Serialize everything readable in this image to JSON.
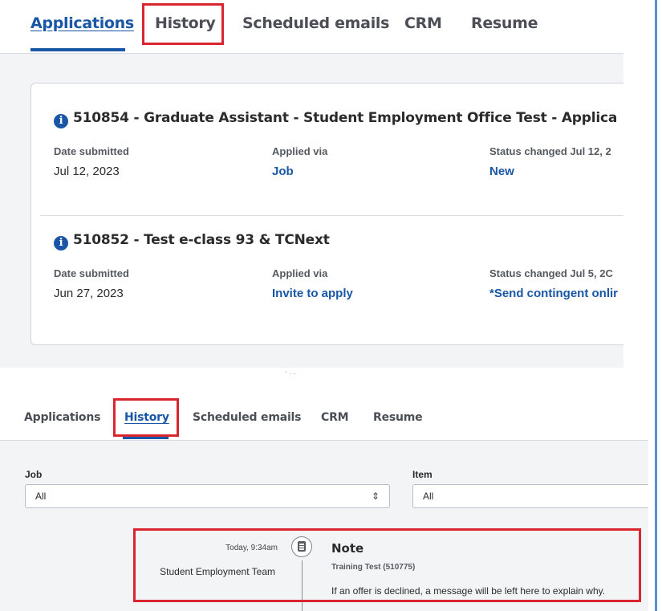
{
  "top_panel": {
    "tabs": [
      {
        "label": "Applications"
      },
      {
        "label": "History"
      },
      {
        "label": "Scheduled emails"
      },
      {
        "label": "CRM"
      },
      {
        "label": "Resume"
      }
    ],
    "applications": [
      {
        "title": "510854 - Graduate Assistant - Student Employment Office Test - Applica",
        "date_label": "Date submitted",
        "date_value": "Jul 12, 2023",
        "via_label": "Applied via",
        "via_value": "Job",
        "status_label": "Status changed Jul 12, 2",
        "status_value": "New"
      },
      {
        "title": "510852 - Test e-class 93 & TCNext",
        "date_label": "Date submitted",
        "date_value": "Jun 27, 2023",
        "via_label": "Applied via",
        "via_value": "Invite to apply",
        "status_label": "Status changed Jul 5, 2C",
        "status_value": "*Send contingent onlir"
      }
    ]
  },
  "bottom_panel": {
    "faint_text": "- ...",
    "tabs": [
      {
        "label": "Applications"
      },
      {
        "label": "History"
      },
      {
        "label": "Scheduled emails"
      },
      {
        "label": "CRM"
      },
      {
        "label": "Resume"
      }
    ],
    "filters": {
      "job_label": "Job",
      "job_value": "All",
      "item_label": "Item",
      "item_value": "All"
    },
    "history_entry": {
      "timestamp": "Today, 9:34am",
      "author": "Student Employment Team",
      "type": "Note",
      "subtitle": "Training Test (510775)",
      "body": "If an offer is declined, a message will be left here to explain why."
    }
  },
  "colors": {
    "accent": "#1a56a6",
    "highlight": "#d9252f",
    "panel_bg": "#f3f4f6"
  }
}
